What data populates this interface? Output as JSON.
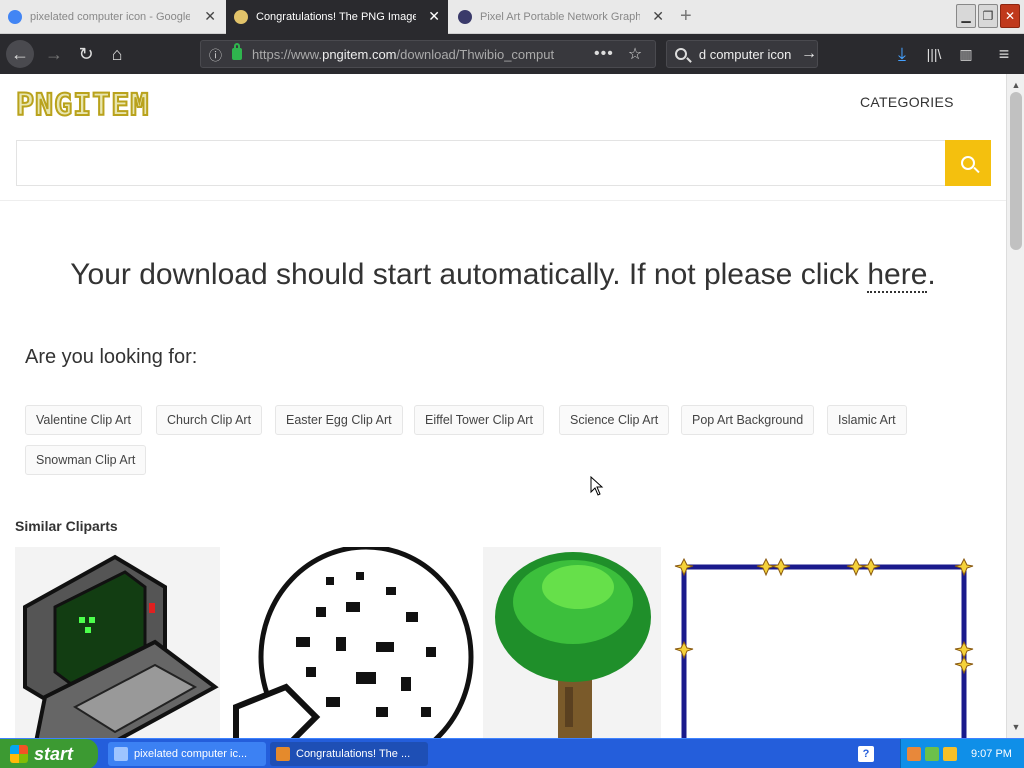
{
  "browser": {
    "tabs": [
      {
        "title": "pixelated computer icon - Google",
        "favicon_color": "#4285f4",
        "state": "inactive"
      },
      {
        "title": "Congratulations! The PNG Image Has",
        "favicon_color": "#e2c36a",
        "state": "active"
      },
      {
        "title": "Pixel Art Portable Network Graphics",
        "favicon_color": "#f2c31b",
        "state": "inactive"
      }
    ],
    "url_prefix": "https://www.",
    "url_domain": "pngitem.com",
    "url_path": "/download/Thwibio_comput",
    "search_query": "d computer icon"
  },
  "page": {
    "logo_text": "PNGITEM",
    "categories_label": "CATEGORIES",
    "search_placeholder": "",
    "download_message": "Your download should start automatically. If not please click ",
    "download_link": "here",
    "download_end": ".",
    "looking_for_label": "Are you looking for:",
    "tags": [
      "Valentine Clip Art",
      "Church Clip Art",
      "Easter Egg Clip Art",
      "Eiffel Tower Clip Art",
      "Science Clip Art",
      "Pop Art Background",
      "Islamic Art",
      "Snowman Clip Art"
    ],
    "similar_label": "Similar Cliparts"
  },
  "taskbar": {
    "start_label": "start",
    "tasks": [
      {
        "label": "pixelated computer ic..."
      },
      {
        "label": "Congratulations! The ..."
      }
    ],
    "clock": "9:07 PM"
  },
  "colors": {
    "accent": "#f4c00e",
    "toolbar": "#2a2a2e",
    "taskbar": "#245edb"
  }
}
